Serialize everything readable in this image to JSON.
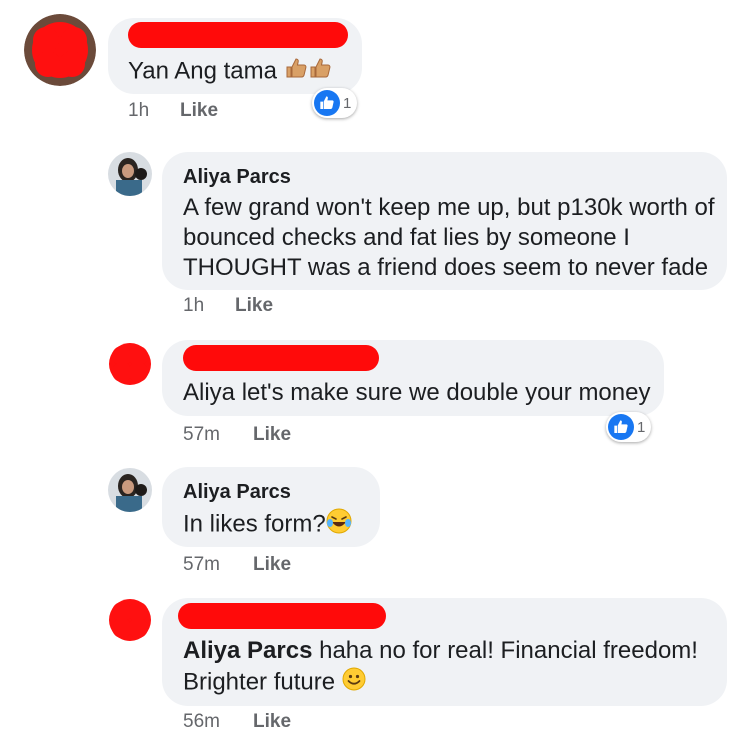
{
  "comments": [
    {
      "id": "c1",
      "author": "",
      "author_redacted": true,
      "text": "Yan Ang tama",
      "emojis": [
        "thumbs-up-icon",
        "thumbs-up-icon"
      ],
      "time": "1h",
      "like_label": "Like",
      "reaction_count": "1"
    },
    {
      "id": "c2",
      "author": "Aliya Parcs",
      "lines": [
        "A few grand won't keep me up, but p130k worth of",
        "bounced checks and fat lies by someone I",
        "THOUGHT was a friend does seem to never fade"
      ],
      "time": "1h",
      "like_label": "Like"
    },
    {
      "id": "c3",
      "author": "",
      "author_redacted": true,
      "text": "Aliya let's make sure we double your money",
      "time": "57m",
      "like_label": "Like",
      "reaction_count": "1"
    },
    {
      "id": "c4",
      "author": "Aliya Parcs",
      "text": "In likes form?",
      "emoji": "laughing-tears-icon",
      "time": "57m",
      "like_label": "Like"
    },
    {
      "id": "c5",
      "author": "",
      "author_redacted": true,
      "mention": "Aliya Parcs",
      "text_line1": " haha no for real! Financial freedom!",
      "text_line2": "Brighter future",
      "emoji": "smiley-icon",
      "time": "56m",
      "like_label": "Like"
    }
  ],
  "colors": {
    "bubble": "#f0f2f5",
    "meta_text": "#65676b",
    "like_blue": "#1877f2",
    "redaction": "#ff0a0a"
  }
}
